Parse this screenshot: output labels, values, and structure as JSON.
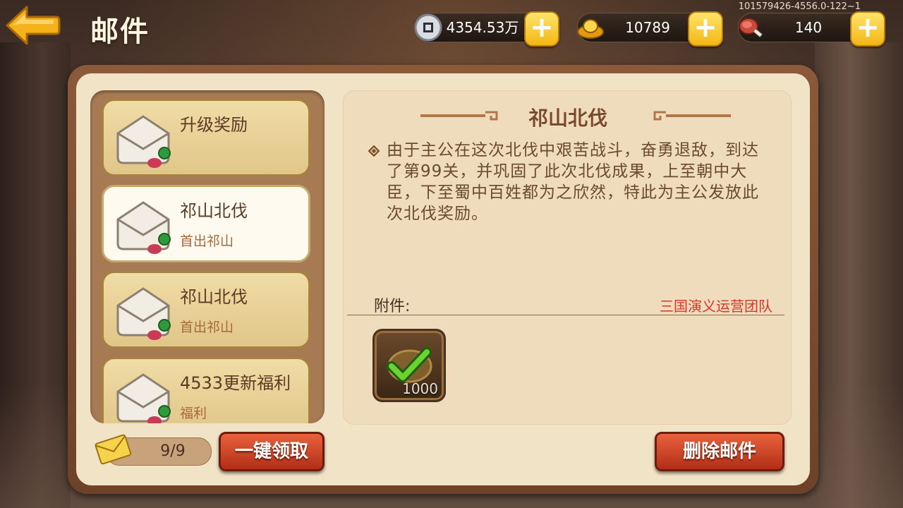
{
  "header": {
    "title": "邮件",
    "debug_id": "101579426-4556.0-122~1"
  },
  "resources": {
    "coins": {
      "value": "4354.53万",
      "icon": "coin-icon"
    },
    "gold": {
      "value": "10789",
      "icon": "gold-ingot-icon"
    },
    "stamina": {
      "value": "140",
      "icon": "meat-icon"
    }
  },
  "mail_list": [
    {
      "title": "升级奖励",
      "subtitle": ""
    },
    {
      "title": "祁山北伐",
      "subtitle": "首出祁山"
    },
    {
      "title": "祁山北伐",
      "subtitle": "首出祁山"
    },
    {
      "title": "4533更新福利",
      "subtitle": "福利"
    }
  ],
  "detail": {
    "title": "祁山北伐",
    "body": "由于主公在这次北伐中艰苦战斗，奋勇退敌，到达了第99关，并巩固了此次北伐成果，上至朝中大臣，下至蜀中百姓都为之欣然，特此为主公发放此次北伐奖励。",
    "attachments_label": "附件:",
    "sender": "三国演义运营团队",
    "attachment": {
      "count": "1000",
      "claimed": true
    }
  },
  "footer": {
    "mail_count": "9/9",
    "claim_all_label": "一键领取",
    "delete_label": "删除邮件"
  },
  "colors": {
    "accent_gold": "#f3b614",
    "button_red": "#c23a1e",
    "sender_red": "#d8352a"
  }
}
